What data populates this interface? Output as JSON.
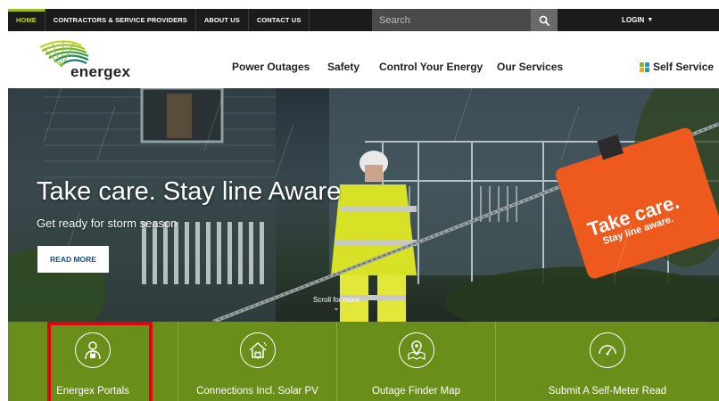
{
  "topbar": {
    "links": [
      {
        "label": "HOME",
        "active": true
      },
      {
        "label": "CONTRACTORS & SERVICE PROVIDERS",
        "active": false
      },
      {
        "label": "ABOUT US",
        "active": false
      },
      {
        "label": "CONTACT US",
        "active": false
      }
    ],
    "search_placeholder": "Search",
    "search_icon": "search-icon",
    "login_label": "LOGIN"
  },
  "header": {
    "logo_text": "energex",
    "nav": [
      "Power Outages",
      "Safety",
      "Control Your Energy",
      "Our Services"
    ],
    "self_service_label": "Self Service"
  },
  "hero": {
    "title": "Take care. Stay line Aware",
    "subtitle": "Get ready for storm season",
    "cta_label": "READ MORE",
    "scroll_label": "Scroll for more",
    "sign_line1": "Take care.",
    "sign_line2": "Stay line aware."
  },
  "quick_links": [
    {
      "label": "Energex Portals",
      "icon": "user-lock-icon"
    },
    {
      "label": "Connections Incl. Solar PV",
      "icon": "house-plug-icon"
    },
    {
      "label": "Outage Finder Map",
      "icon": "map-pin-icon"
    },
    {
      "label": "Submit A Self-Meter Read",
      "icon": "gauge-icon"
    }
  ],
  "colors": {
    "brand_green": "#6a8e1a",
    "accent_lime": "#c7d52b",
    "highlight_red": "#e5000f",
    "topbar": "#1b1b1b",
    "self_service_dots": [
      "#7cbc2c",
      "#2f8fce",
      "#f2a51c",
      "#2e9a8f"
    ]
  }
}
